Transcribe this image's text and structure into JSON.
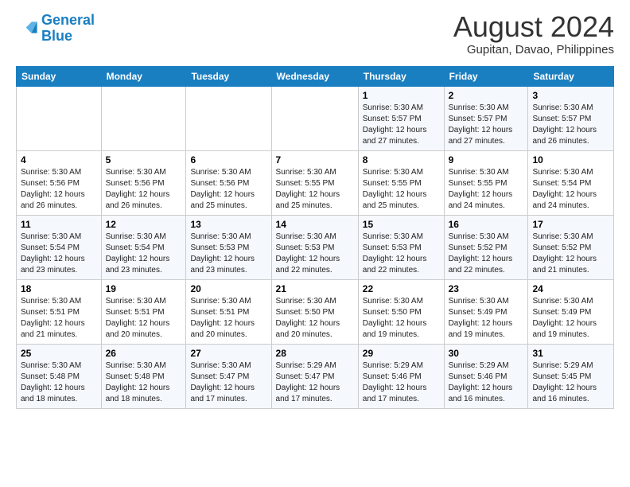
{
  "logo": {
    "line1": "General",
    "line2": "Blue"
  },
  "title": "August 2024",
  "location": "Gupitan, Davao, Philippines",
  "days_of_week": [
    "Sunday",
    "Monday",
    "Tuesday",
    "Wednesday",
    "Thursday",
    "Friday",
    "Saturday"
  ],
  "weeks": [
    [
      {
        "day": "",
        "detail": ""
      },
      {
        "day": "",
        "detail": ""
      },
      {
        "day": "",
        "detail": ""
      },
      {
        "day": "",
        "detail": ""
      },
      {
        "day": "1",
        "detail": "Sunrise: 5:30 AM\nSunset: 5:57 PM\nDaylight: 12 hours\nand 27 minutes."
      },
      {
        "day": "2",
        "detail": "Sunrise: 5:30 AM\nSunset: 5:57 PM\nDaylight: 12 hours\nand 27 minutes."
      },
      {
        "day": "3",
        "detail": "Sunrise: 5:30 AM\nSunset: 5:57 PM\nDaylight: 12 hours\nand 26 minutes."
      }
    ],
    [
      {
        "day": "4",
        "detail": "Sunrise: 5:30 AM\nSunset: 5:56 PM\nDaylight: 12 hours\nand 26 minutes."
      },
      {
        "day": "5",
        "detail": "Sunrise: 5:30 AM\nSunset: 5:56 PM\nDaylight: 12 hours\nand 26 minutes."
      },
      {
        "day": "6",
        "detail": "Sunrise: 5:30 AM\nSunset: 5:56 PM\nDaylight: 12 hours\nand 25 minutes."
      },
      {
        "day": "7",
        "detail": "Sunrise: 5:30 AM\nSunset: 5:55 PM\nDaylight: 12 hours\nand 25 minutes."
      },
      {
        "day": "8",
        "detail": "Sunrise: 5:30 AM\nSunset: 5:55 PM\nDaylight: 12 hours\nand 25 minutes."
      },
      {
        "day": "9",
        "detail": "Sunrise: 5:30 AM\nSunset: 5:55 PM\nDaylight: 12 hours\nand 24 minutes."
      },
      {
        "day": "10",
        "detail": "Sunrise: 5:30 AM\nSunset: 5:54 PM\nDaylight: 12 hours\nand 24 minutes."
      }
    ],
    [
      {
        "day": "11",
        "detail": "Sunrise: 5:30 AM\nSunset: 5:54 PM\nDaylight: 12 hours\nand 23 minutes."
      },
      {
        "day": "12",
        "detail": "Sunrise: 5:30 AM\nSunset: 5:54 PM\nDaylight: 12 hours\nand 23 minutes."
      },
      {
        "day": "13",
        "detail": "Sunrise: 5:30 AM\nSunset: 5:53 PM\nDaylight: 12 hours\nand 23 minutes."
      },
      {
        "day": "14",
        "detail": "Sunrise: 5:30 AM\nSunset: 5:53 PM\nDaylight: 12 hours\nand 22 minutes."
      },
      {
        "day": "15",
        "detail": "Sunrise: 5:30 AM\nSunset: 5:53 PM\nDaylight: 12 hours\nand 22 minutes."
      },
      {
        "day": "16",
        "detail": "Sunrise: 5:30 AM\nSunset: 5:52 PM\nDaylight: 12 hours\nand 22 minutes."
      },
      {
        "day": "17",
        "detail": "Sunrise: 5:30 AM\nSunset: 5:52 PM\nDaylight: 12 hours\nand 21 minutes."
      }
    ],
    [
      {
        "day": "18",
        "detail": "Sunrise: 5:30 AM\nSunset: 5:51 PM\nDaylight: 12 hours\nand 21 minutes."
      },
      {
        "day": "19",
        "detail": "Sunrise: 5:30 AM\nSunset: 5:51 PM\nDaylight: 12 hours\nand 20 minutes."
      },
      {
        "day": "20",
        "detail": "Sunrise: 5:30 AM\nSunset: 5:51 PM\nDaylight: 12 hours\nand 20 minutes."
      },
      {
        "day": "21",
        "detail": "Sunrise: 5:30 AM\nSunset: 5:50 PM\nDaylight: 12 hours\nand 20 minutes."
      },
      {
        "day": "22",
        "detail": "Sunrise: 5:30 AM\nSunset: 5:50 PM\nDaylight: 12 hours\nand 19 minutes."
      },
      {
        "day": "23",
        "detail": "Sunrise: 5:30 AM\nSunset: 5:49 PM\nDaylight: 12 hours\nand 19 minutes."
      },
      {
        "day": "24",
        "detail": "Sunrise: 5:30 AM\nSunset: 5:49 PM\nDaylight: 12 hours\nand 19 minutes."
      }
    ],
    [
      {
        "day": "25",
        "detail": "Sunrise: 5:30 AM\nSunset: 5:48 PM\nDaylight: 12 hours\nand 18 minutes."
      },
      {
        "day": "26",
        "detail": "Sunrise: 5:30 AM\nSunset: 5:48 PM\nDaylight: 12 hours\nand 18 minutes."
      },
      {
        "day": "27",
        "detail": "Sunrise: 5:30 AM\nSunset: 5:47 PM\nDaylight: 12 hours\nand 17 minutes."
      },
      {
        "day": "28",
        "detail": "Sunrise: 5:29 AM\nSunset: 5:47 PM\nDaylight: 12 hours\nand 17 minutes."
      },
      {
        "day": "29",
        "detail": "Sunrise: 5:29 AM\nSunset: 5:46 PM\nDaylight: 12 hours\nand 17 minutes."
      },
      {
        "day": "30",
        "detail": "Sunrise: 5:29 AM\nSunset: 5:46 PM\nDaylight: 12 hours\nand 16 minutes."
      },
      {
        "day": "31",
        "detail": "Sunrise: 5:29 AM\nSunset: 5:45 PM\nDaylight: 12 hours\nand 16 minutes."
      }
    ]
  ]
}
